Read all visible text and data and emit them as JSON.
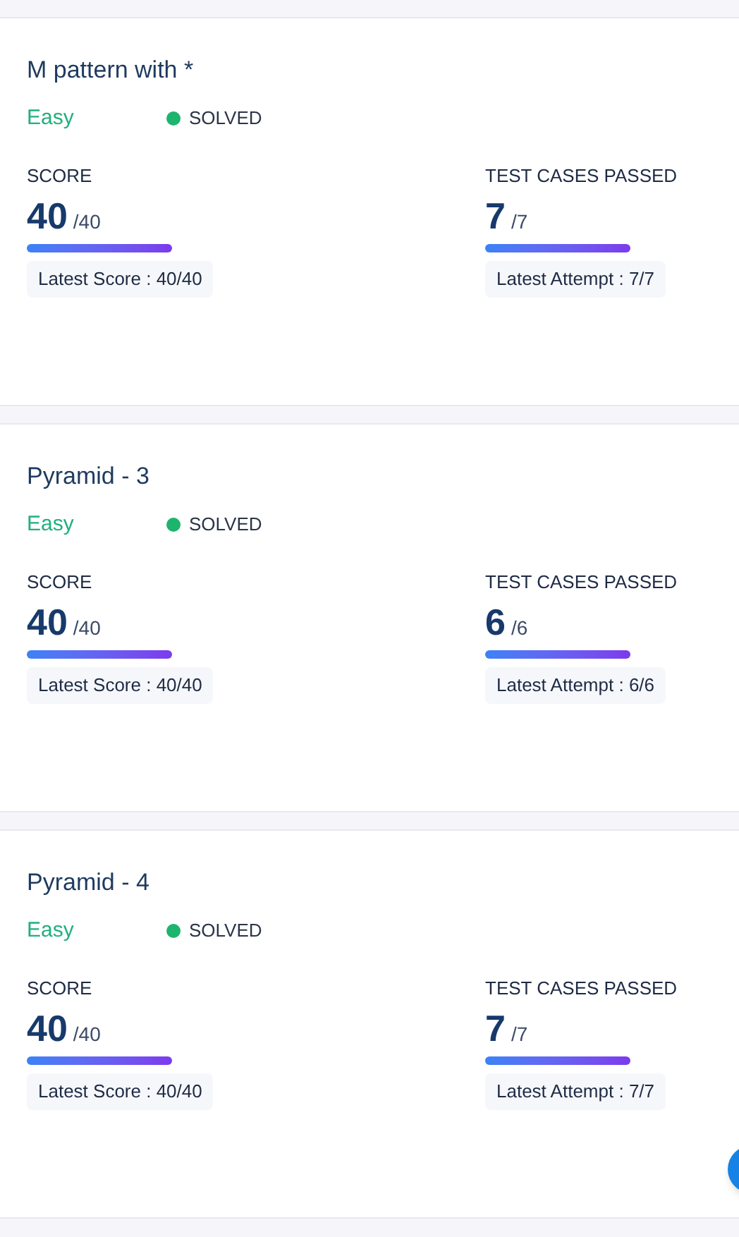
{
  "problems": [
    {
      "title": "M pattern with *",
      "difficulty": "Easy",
      "status": "SOLVED",
      "solved": true,
      "score": {
        "label": "SCORE",
        "value": "40",
        "total": "/40",
        "latest": "Latest Score : 40/40"
      },
      "tests": {
        "label": "TEST CASES PASSED",
        "value": "7",
        "total": "/7",
        "latest": "Latest Attempt : 7/7"
      }
    },
    {
      "title": "Pyramid - 3",
      "difficulty": "Easy",
      "status": "SOLVED",
      "solved": true,
      "score": {
        "label": "SCORE",
        "value": "40",
        "total": "/40",
        "latest": "Latest Score : 40/40"
      },
      "tests": {
        "label": "TEST CASES PASSED",
        "value": "6",
        "total": "/6",
        "latest": "Latest Attempt : 6/6"
      }
    },
    {
      "title": "Pyramid - 4",
      "difficulty": "Easy",
      "status": "SOLVED",
      "solved": true,
      "score": {
        "label": "SCORE",
        "value": "40",
        "total": "/40",
        "latest": "Latest Score : 40/40"
      },
      "tests": {
        "label": "TEST CASES PASSED",
        "value": "7",
        "total": "/7",
        "latest": "Latest Attempt : 7/7"
      }
    }
  ]
}
